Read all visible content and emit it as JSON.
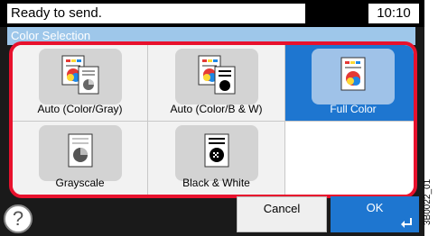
{
  "status": {
    "message": "Ready to send.",
    "time": "10:10"
  },
  "title": "Color Selection",
  "options": [
    {
      "label": "Auto (Color/Gray)",
      "icon": "auto-color-gray-icon",
      "selected": false
    },
    {
      "label": "Auto (Color/B & W)",
      "icon": "auto-color-bw-icon",
      "selected": false
    },
    {
      "label": "Full Color",
      "icon": "full-color-icon",
      "selected": true
    },
    {
      "label": "Grayscale",
      "icon": "grayscale-icon",
      "selected": false
    },
    {
      "label": "Black & White",
      "icon": "black-white-icon",
      "selected": false
    }
  ],
  "footer": {
    "help_symbol": "?",
    "cancel_label": "Cancel",
    "ok_label": "OK"
  },
  "reference_code": "3B0022_01",
  "colors": {
    "selected": "#1e76d0",
    "highlight_border": "#e8112d",
    "title_bar": "#9ec7ea"
  }
}
